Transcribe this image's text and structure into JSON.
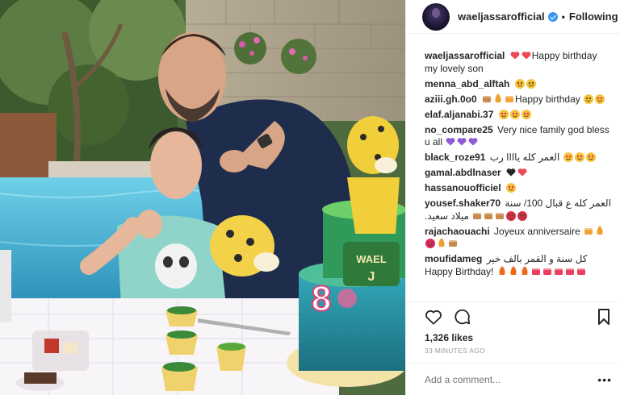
{
  "post": {
    "username": "waeljassarofficial",
    "follow_label": "Following",
    "separator": "•",
    "comments": [
      {
        "user": "waeljassarofficial",
        "text": "Happy birthday my lovely son",
        "emoji": [
          "heart",
          "heart"
        ]
      },
      {
        "user": "menna_abd_alftah",
        "text": "",
        "emoji": [
          "laugh",
          "laugh"
        ]
      },
      {
        "user": "aziii.gh.0o0",
        "text": "Happy birthday",
        "emoji": [
          "cake",
          "party",
          "gift"
        ],
        "emoji_after": [
          "smile",
          "hearteyes"
        ]
      },
      {
        "user": "elaf.aljanabi.37",
        "text": "",
        "emoji": [
          "hearteyes",
          "hearteyes",
          "hearteyes"
        ]
      },
      {
        "user": "no_compare25",
        "text": "Very nice family god bless u all",
        "emoji_after": [
          "purple",
          "purple",
          "purple"
        ]
      },
      {
        "user": "black_roze91",
        "text": "العمر كله ياااا رب",
        "emoji_after": [
          "hearteyes",
          "hearteyes",
          "hearteyes"
        ]
      },
      {
        "user": "gamal.abdlnaser",
        "text": "",
        "emoji": [
          "blackheart",
          "heart"
        ]
      },
      {
        "user": "hassanouofficiel",
        "text": "",
        "emoji": [
          "hearteyes"
        ]
      },
      {
        "user": "yousef.shaker70",
        "text": "العمر كله ع قبال 100/ سنة ميلاد سعيد.",
        "emoji_after": [
          "cake",
          "cake",
          "cake",
          "rose",
          "rose"
        ]
      },
      {
        "user": "rajachaouachi",
        "text": "Joyeux anniversaire",
        "emoji_after": [
          "gift",
          "party",
          "balloon",
          "party",
          "cake"
        ]
      },
      {
        "user": "moufidameg",
        "text": "كل سنة و القمر بالف خير",
        "text2": "Happy Birthday!",
        "emoji_after": [
          "fire",
          "fire",
          "fire",
          "box",
          "box",
          "box",
          "box",
          "box"
        ]
      }
    ],
    "likes": "1,326 likes",
    "time": "33 MINUTES AGO",
    "add_comment_placeholder": "Add a comment...",
    "more_label": "•••",
    "cake_name": "WAEL J",
    "cake_number": "8"
  },
  "icons": {
    "like": "heart-outline-icon",
    "comment": "comment-bubble-icon",
    "save": "bookmark-icon",
    "more": "more-options-icon"
  },
  "colors": {
    "accent": "#3897f0",
    "heart_red": "#ed4956",
    "muted": "#999999"
  }
}
